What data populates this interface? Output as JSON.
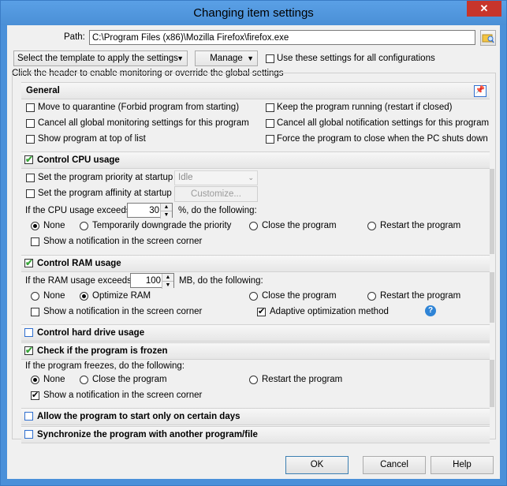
{
  "window": {
    "title": "Changing item settings"
  },
  "path": {
    "label": "Path:",
    "value": "C:\\Program Files (x86)\\Mozilla Firefox\\firefox.exe"
  },
  "template": {
    "select_label": "Select the template to apply the settings",
    "manage_label": "Manage",
    "all_configs_label": "Use these settings for all configurations",
    "all_configs_checked": false
  },
  "hint": "Click the header to enable monitoring or override the global settings",
  "general": {
    "header": "General",
    "options": [
      {
        "label": "Move to quarantine (Forbid program from starting)",
        "checked": false
      },
      {
        "label": "Keep the program running (restart if closed)",
        "checked": false
      },
      {
        "label": "Cancel all global monitoring settings for this program",
        "checked": false
      },
      {
        "label": "Cancel all global notification settings for this program",
        "checked": false
      },
      {
        "label": "Show program at top of list",
        "checked": false
      },
      {
        "label": "Force the program to close when the PC shuts down",
        "checked": false
      }
    ]
  },
  "cpu": {
    "header": "Control CPU usage",
    "enabled": true,
    "priority_label": "Set the program priority at startup",
    "priority_value": "Idle",
    "affinity_label": "Set the program affinity at startup",
    "customize_label": "Customize...",
    "exceeds_label": "If the CPU usage exceeds",
    "exceeds_value": "30",
    "exceeds_suffix": "%, do the following:",
    "actions": [
      "None",
      "Temporarily downgrade the priority",
      "Close the program",
      "Restart the program"
    ],
    "selected_action": "None",
    "notify_label": "Show a notification in the screen corner",
    "notify_checked": false
  },
  "ram": {
    "header": "Control RAM usage",
    "enabled": true,
    "exceeds_label": "If the RAM usage exceeds",
    "exceeds_value": "100",
    "exceeds_suffix": "MB, do the following:",
    "actions": [
      "None",
      "Optimize RAM",
      "Close the program",
      "Restart the program"
    ],
    "selected_action": "Optimize RAM",
    "notify_label": "Show a notification in the screen corner",
    "notify_checked": false,
    "adaptive_label": "Adaptive optimization method",
    "adaptive_checked": true
  },
  "hdd": {
    "header": "Control hard drive usage",
    "enabled": false
  },
  "frozen": {
    "header": "Check if the program is frozen",
    "enabled": true,
    "freezes_label": "If the program freezes, do the following:",
    "actions": [
      "None",
      "Close the program",
      "Restart the program"
    ],
    "selected_action": "None",
    "notify_label": "Show a notification in the screen corner",
    "notify_checked": true
  },
  "days": {
    "header": "Allow the program to start only on certain days",
    "enabled": false
  },
  "sync": {
    "header": "Synchronize the program with another program/file",
    "enabled": false
  },
  "buttons": {
    "ok": "OK",
    "cancel": "Cancel",
    "help": "Help"
  },
  "colors": {
    "titlebar": "#4a90d9",
    "close": "#c7352b",
    "check_green": "#3aa53a",
    "help_blue": "#2f84d6"
  }
}
